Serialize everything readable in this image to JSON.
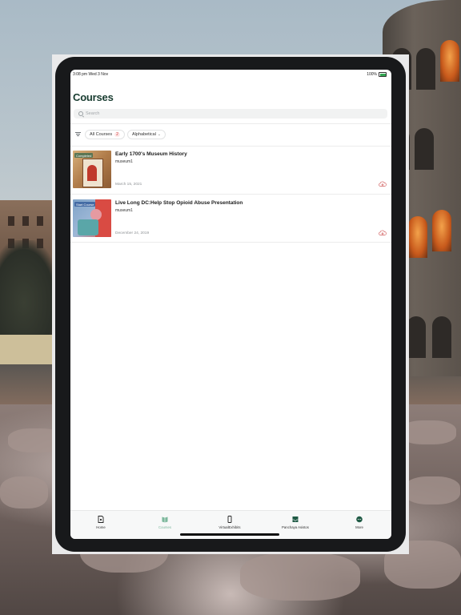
{
  "status_bar": {
    "time": "3:08 pm  Wed 3 Nov",
    "battery": "100%"
  },
  "page": {
    "title": "Courses"
  },
  "search": {
    "placeholder": "Search"
  },
  "filters": {
    "all_courses_label": "All Courses",
    "all_courses_count": "2",
    "sort_label": "Alphabetical",
    "sort_caret": "⌄"
  },
  "courses": [
    {
      "title": "Early 1700's Museum History",
      "author": "museum1",
      "date": "March 15, 2021",
      "thumb_badge": "Completed"
    },
    {
      "title": "Live Long DC:Help Stop Opioid Abuse Presentation",
      "author": "museum1",
      "date": "December 24, 2019",
      "thumb_badge": "Start Course"
    }
  ],
  "tabs": [
    {
      "label": "Home",
      "icon": "home-icon"
    },
    {
      "label": "Courses",
      "icon": "book-icon"
    },
    {
      "label": "VirtualExhibits",
      "icon": "phone-icon"
    },
    {
      "label": "Panchaya Asistos",
      "icon": "inbox-icon"
    },
    {
      "label": "More",
      "icon": "more-icon"
    }
  ],
  "colors": {
    "title": "#173b2f",
    "active_tab": "#7db89d",
    "download": "#d05a5a",
    "badge_count_bg": "#fde9e9"
  }
}
